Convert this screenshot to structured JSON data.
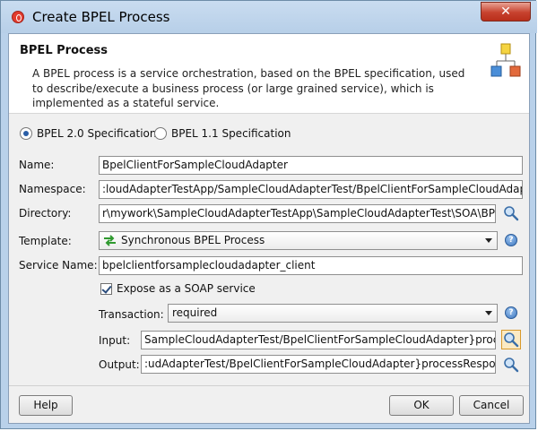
{
  "window": {
    "title": "Create BPEL Process",
    "close_label": "✕"
  },
  "header": {
    "title": "BPEL Process",
    "description": "A BPEL process is a service orchestration, based on the BPEL specification, used to describe/execute a business process (or large grained service), which is implemented as a stateful service."
  },
  "spec": {
    "options": [
      "BPEL 2.0 Specification",
      "BPEL 1.1 Specification"
    ],
    "selected": "BPEL 2.0 Specification"
  },
  "form": {
    "name_label": "Name:",
    "name_value": "BpelClientForSampleCloudAdapter",
    "namespace_label": "Namespace:",
    "namespace_value": ":loudAdapterTestApp/SampleCloudAdapterTest/BpelClientForSampleCloudAdapter",
    "directory_label": "Directory:",
    "directory_value": "r\\mywork\\SampleCloudAdapterTestApp\\SampleCloudAdapterTest\\SOA\\BPEL",
    "template_label": "Template:",
    "template_value": "Synchronous BPEL Process",
    "service_name_label": "Service Name:",
    "service_name_value": "bpelclientforsamplecloudadapter_client",
    "expose_label": "Expose as a SOAP service",
    "expose_checked": true,
    "transaction_label": "Transaction:",
    "transaction_value": "required",
    "input_label": "Input:",
    "input_value": "SampleCloudAdapterTest/BpelClientForSampleCloudAdapter}process",
    "output_label": "Output:",
    "output_value": ":udAdapterTest/BpelClientForSampleCloudAdapter}processResponse"
  },
  "buttons": {
    "help": "Help",
    "ok": "OK",
    "cancel": "Cancel"
  },
  "icons": {
    "app": "oracle-jdeveloper-icon",
    "header": "bpel-process-icon",
    "search": "magnifier-icon",
    "help": "help-icon",
    "template": "sync-arrows-icon"
  }
}
